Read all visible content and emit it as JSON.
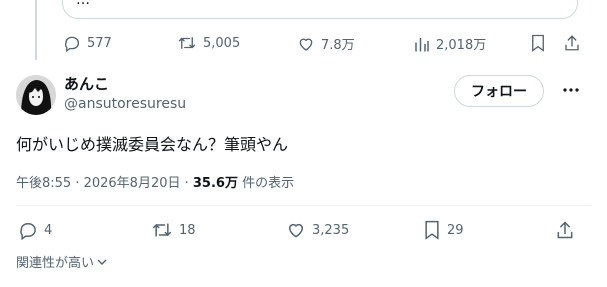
{
  "previous_tweet": {
    "quote_text": "…",
    "actions": {
      "replies": "577",
      "retweets": "5,005",
      "likes": "7.8万",
      "views": "2,018万"
    }
  },
  "tweet": {
    "author": {
      "name": "あんこ",
      "handle": "@ansutoresuresu"
    },
    "follow_label": "フォロー",
    "text": "何がいじめ撲滅委員会なん？筆頭やん",
    "timestamp": "午後8:55 · 2026年8月20日 · ",
    "views_count": "35.6万",
    "views_label": " 件の表示",
    "actions": {
      "replies": "4",
      "retweets": "18",
      "likes": "3,235",
      "bookmarks": "29"
    },
    "related_label": "関連性が高い"
  },
  "colors": {
    "text": "#0f1419",
    "secondary": "#536471",
    "border": "#cfd9de"
  }
}
